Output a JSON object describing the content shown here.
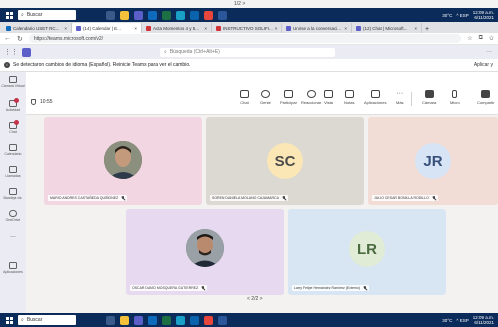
{
  "top_strip": {
    "pager": "1/2 >"
  },
  "taskbar": {
    "search_placeholder": "Buscar",
    "temperature": "30°C",
    "tray_text": "^  ESP",
    "time": "12:09 a.m.",
    "date": "6/11/2021",
    "colors": {
      "bar": "#0b2b5a"
    }
  },
  "browser": {
    "tabs": [
      {
        "label": "Calendario USET RC...",
        "icon": "calendar-favicon",
        "color": "#0f6cbd"
      },
      {
        "label": "(14) Calendar | E...",
        "icon": "teams-favicon",
        "color": "#5b5fc7"
      },
      {
        "label": "Acta Momentos 4 y 5...",
        "icon": "pdf-favicon",
        "color": "#d13438"
      },
      {
        "label": "INSTRUCTIVO SOLIFI...",
        "icon": "pdf-favicon",
        "color": "#d13438"
      },
      {
        "label": "Unirse a la conversaci...",
        "icon": "teams-favicon",
        "color": "#5b5fc7"
      },
      {
        "label": "(12) Chat | Microsoft...",
        "icon": "teams-favicon",
        "color": "#5b5fc7"
      }
    ],
    "new_tab": "+",
    "url": "https://teams.microsoft.com/v2/"
  },
  "teams": {
    "search_placeholder": "Búsqueda (Ctrl+Alt+E)",
    "banner_text": "Se detectaron cambios de idioma (Español). Reinicie Teams para ver el cambio.",
    "banner_action": "Aplicar y",
    "rail": [
      {
        "label": "Cámara Virtual",
        "icon": "camera-icon"
      },
      {
        "label": "Actividad",
        "icon": "bell-icon",
        "badge": true
      },
      {
        "label": "Chat",
        "icon": "chat-icon",
        "badge": true
      },
      {
        "label": "Calendario",
        "icon": "calendar-icon"
      },
      {
        "label": "Llamadas",
        "icon": "phone-icon"
      },
      {
        "label": "Bandeja vis.",
        "icon": "folder-icon"
      },
      {
        "label": "OneDrive",
        "icon": "cloud-icon"
      },
      {
        "label": "...",
        "icon": "more-icon"
      },
      {
        "label": "Aplicaciones",
        "icon": "apps-icon"
      }
    ],
    "meeting_timer": "10:55",
    "controls": [
      {
        "label": "Chat",
        "icon": "chat-icon"
      },
      {
        "label": "Gente",
        "icon": "people-icon",
        "count": "14"
      },
      {
        "label": "Participar",
        "icon": "hand-icon"
      },
      {
        "label": "Reaccionar",
        "icon": "smile-icon"
      },
      {
        "label": "Vista",
        "icon": "grid-icon"
      },
      {
        "label": "Notas",
        "icon": "notes-icon"
      },
      {
        "label": "Aplicaciones",
        "icon": "apps-icon"
      },
      {
        "label": "Más",
        "icon": "more-icon"
      },
      {
        "label": "Cámara",
        "icon": "camera-icon"
      },
      {
        "label": "Micro",
        "icon": "mic-icon"
      },
      {
        "label": "Compartir",
        "icon": "share-icon"
      }
    ],
    "participants": [
      {
        "name": "MARIO ANDRES CASTAÑEDA QUIÑONEZ",
        "initials": "",
        "bg": "#f2d7e3",
        "avatar": "photo"
      },
      {
        "name": "SOREN DANIELA MOLANO CAJAMARCA",
        "initials": "SC",
        "bg": "#dcd8d2",
        "circle": "#fbe7b6",
        "fg": "#4b4b4b"
      },
      {
        "name": "JULIO CESAR BONILLA RODILLO",
        "initials": "JR",
        "bg": "#f2dcd6",
        "circle": "#d6e4f5",
        "fg": "#38507a"
      },
      {
        "name": "OSCAR DAVID MOSQUERA GUTIERREZ",
        "initials": "",
        "bg": "#e7d9ef",
        "avatar": "photo"
      },
      {
        "name": "Larry Felipe Hernández Ramírez (Externo)",
        "initials": "LR",
        "bg": "#d8e6f3",
        "circle": "#e1ecd6",
        "fg": "#4b6a40"
      }
    ],
    "stage_pager": "< 2/2 >"
  }
}
